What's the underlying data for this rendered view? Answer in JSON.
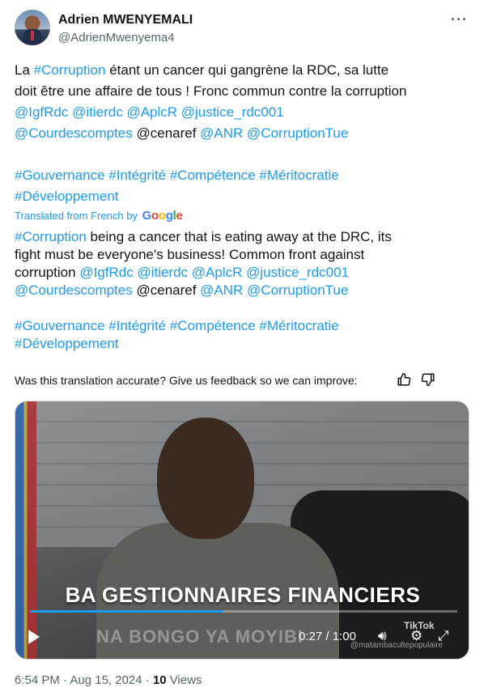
{
  "author": {
    "name": "Adrien MWENYEMALI",
    "handle": "@AdrienMwenyema4",
    "more_icon": "more-horizontal-icon"
  },
  "original": {
    "line1_pre": "La ",
    "line1_tag": "#Corruption",
    "line1_post": " étant un cancer qui gangrène la RDC, sa lutte",
    "line2": "doit être une affaire de tous ! Fronc commun contre la corruption",
    "mentions1": "@IgfRdc @itierdc @AplcR @justice_rdc001",
    "mentions2a": "@Courdescomptes",
    "mentions2b": " @cenaref ",
    "mentions2c": "@ANR @CorruptionTue",
    "tags1": "#Gouvernance #Intégrité #Compétence #Méritocratie",
    "tags2": "#Développement"
  },
  "translation_label": "Translated from French by",
  "translation_provider": "Google",
  "translated": {
    "line1_tag": "#Corruption",
    "line1_post": " being a cancer that is eating away at the DRC, its",
    "line2": "fight must be everyone's business! Common front against",
    "line3_pre": "corruption ",
    "line3_mentions": "@IgfRdc @itierdc @AplcR @justice_rdc001",
    "mentions2a": "@Courdescomptes",
    "mentions2b": " @cenaref ",
    "mentions2c": "@ANR @CorruptionTue",
    "tags1": "#Gouvernance #Intégrité #Compétence #Méritocratie",
    "tags2": "#Développement"
  },
  "feedback_prompt": "Was this translation accurate? Give us feedback so we can improve:",
  "video": {
    "caption_main": "BA GESTIONNAIRES FINANCIERS",
    "caption_sub": "NA BONGO YA MOYIBI",
    "current_time": "0:27",
    "separator": " / ",
    "duration": "1:00",
    "progress": 0.45,
    "watermark": "TikTok",
    "watermark_user": "@matambacultepopulaire"
  },
  "meta": {
    "timestamp": "6:54 PM · Aug 15, 2024 · ",
    "views_count": "10",
    "views_label": " Views"
  },
  "colors": {
    "link": "#1d9bf0",
    "text": "#0f1419",
    "secondary": "#536471"
  }
}
